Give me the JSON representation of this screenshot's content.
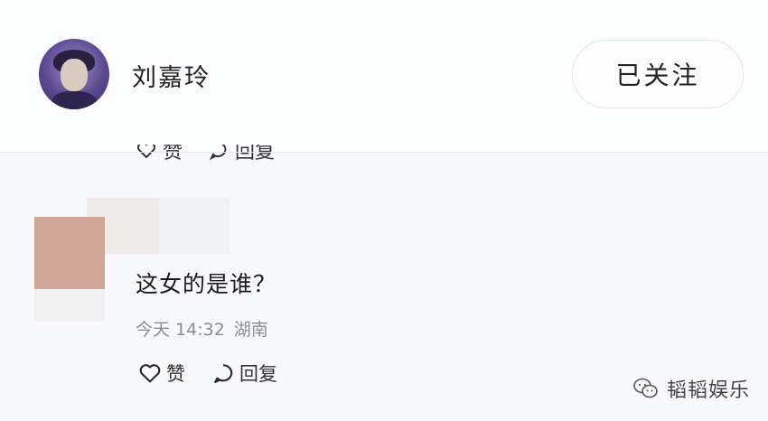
{
  "header": {
    "username": "刘嘉玲",
    "follow_label": "已关注"
  },
  "previous_actions": {
    "like_label": "赞",
    "reply_label": "回复"
  },
  "comment": {
    "text": "这女的是谁？",
    "date": "今天 14:32",
    "location": "湖南",
    "like_label": "赞",
    "reply_label": "回复"
  },
  "watermark": {
    "text": "韬韬娱乐",
    "icon": "wechat-icon"
  },
  "colors": {
    "background": "#f8f9fd",
    "meta_text": "#8a8d96",
    "avatar_purple": "#5c4a91"
  }
}
